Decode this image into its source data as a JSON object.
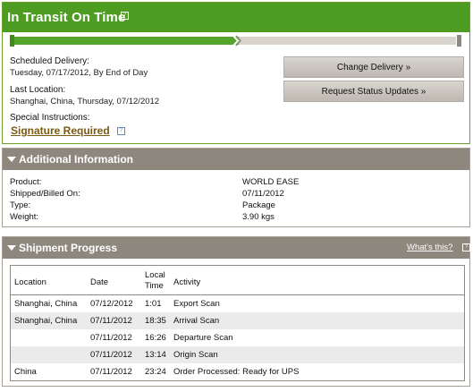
{
  "status": {
    "title": "In Transit On Time",
    "help_icon": "help-icon",
    "progress_fraction": 0.5
  },
  "details": {
    "scheduled_delivery_label": "Scheduled Delivery:",
    "scheduled_delivery_value": "Tuesday, 07/17/2012, By End of Day",
    "last_location_label": "Last Location:",
    "last_location_value": "Shanghai, China, Thursday, 07/12/2012",
    "special_instructions_label": "Special Instructions:",
    "special_instructions_value": "Signature Required"
  },
  "actions": {
    "change_delivery": "Change Delivery »",
    "request_status_updates": "Request Status Updates »"
  },
  "additional_info": {
    "title": "Additional Information",
    "rows": [
      {
        "label": "Product:",
        "value": "WORLD EASE"
      },
      {
        "label": "Shipped/Billed On:",
        "value": "07/11/2012"
      },
      {
        "label": "Type:",
        "value": "Package"
      },
      {
        "label": "Weight:",
        "value": "3.90 kgs"
      }
    ]
  },
  "shipment_progress": {
    "title": "Shipment Progress",
    "whats_this": "What's this?",
    "columns": {
      "location": "Location",
      "date": "Date",
      "local_time_1": "Local",
      "local_time_2": "Time",
      "activity": "Activity"
    },
    "rows": [
      {
        "location": "Shanghai, China",
        "date": "07/12/2012",
        "time": "1:01",
        "activity": "Export Scan"
      },
      {
        "location": "Shanghai, China",
        "date": "07/11/2012",
        "time": "18:35",
        "activity": "Arrival Scan"
      },
      {
        "location": "",
        "date": "07/11/2012",
        "time": "16:26",
        "activity": "Departure Scan"
      },
      {
        "location": "",
        "date": "07/11/2012",
        "time": "13:14",
        "activity": "Origin Scan"
      },
      {
        "location": "China",
        "date": "07/11/2012",
        "time": "23:24",
        "activity": "Order Processed: Ready for UPS"
      }
    ]
  },
  "colors": {
    "status_green": "#4e9c21",
    "section_gray": "#8d877d",
    "link_brown": "#7a5a12"
  }
}
